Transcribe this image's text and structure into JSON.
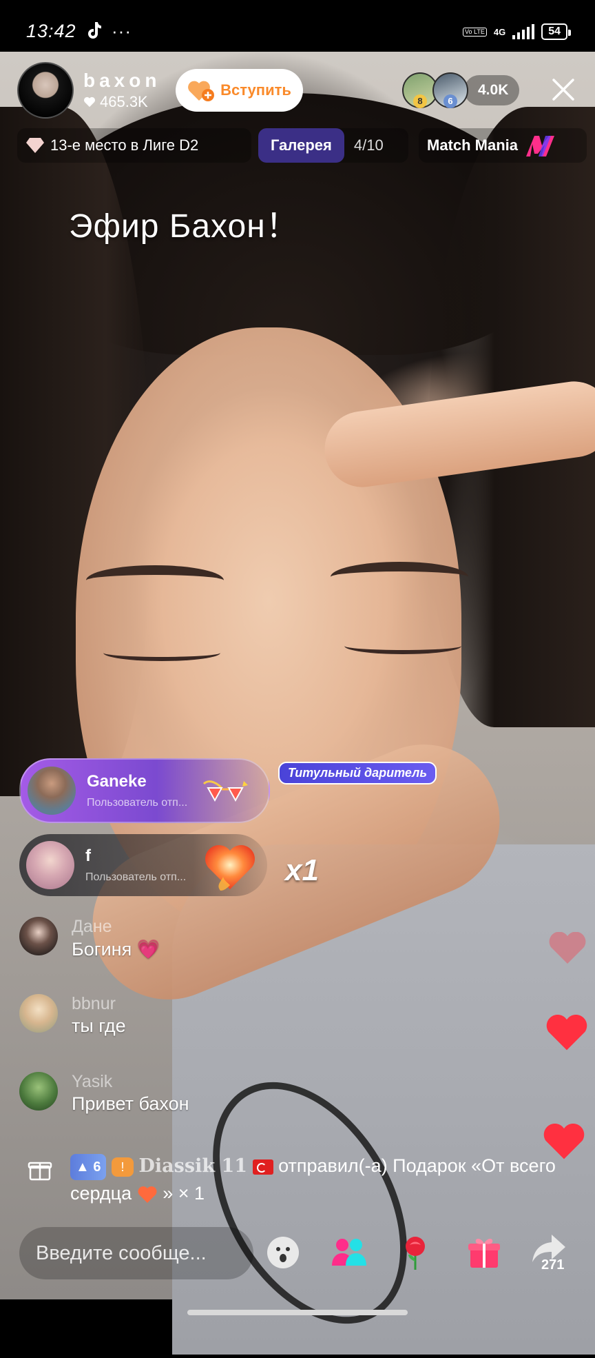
{
  "status_bar": {
    "time": "13:42",
    "dots": "···",
    "network": "4G",
    "volte": "Vo LTE",
    "battery": "54"
  },
  "host": {
    "name": "baxon",
    "likes": "465.3K",
    "join_label": "Вступить"
  },
  "viewers": {
    "badge1": "8",
    "badge2": "6",
    "count": "4.0K"
  },
  "league": {
    "text": "13-е место в Лиге D2"
  },
  "gallery": {
    "label": "Галерея",
    "count": "4/10"
  },
  "match": {
    "label": "Match Mania"
  },
  "overlay_title": "Эфир Бахон！",
  "gifts": [
    {
      "user": "Ganeke",
      "subtitle": "Пользователь  отп...",
      "badge": "Титульный даритель"
    },
    {
      "user": "f",
      "subtitle": "Пользователь  отп...",
      "combo": "x1"
    }
  ],
  "comments": [
    {
      "user": "Дане",
      "text": "Богиня 💗"
    },
    {
      "user": "bbnur",
      "text": "ты где"
    },
    {
      "user": "Yasik",
      "text": "Привет бахон"
    }
  ],
  "system_message": {
    "level": "6",
    "user": "Diassik 11",
    "text_before": "отправил(-а) Подарок «От всего сердца",
    "text_after": "» × 1"
  },
  "bottom_bar": {
    "placeholder": "Введите сообще...",
    "share_count": "271"
  },
  "colors": {
    "accent_orange": "#fa8a2a",
    "gift_purple": "#a45be6",
    "gallery_blue": "#3b2f86",
    "heart_red": "#ff3040"
  },
  "icons": [
    "tiktok-icon",
    "heart-icon",
    "close-icon",
    "diamond-icon",
    "match-mania-icon",
    "gift-box-icon",
    "emoji-icon",
    "multi-guest-icon",
    "rose-icon",
    "gift-icon",
    "share-icon"
  ]
}
